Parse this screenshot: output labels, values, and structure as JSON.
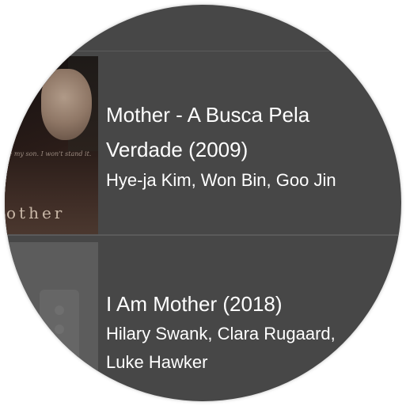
{
  "results": [
    {
      "title": "Mother - A Busca Pela Verdade (2009)",
      "cast": "Hye-ja Kim, Won Bin, Goo Jin",
      "poster": {
        "tagline": "le my son. I won't stand it.",
        "title_text": "other"
      }
    },
    {
      "title": "I Am Mother (2018)",
      "cast": "Hilary Swank, Clara Rugaard, Luke Hawker"
    }
  ],
  "colors": {
    "background": "#474747",
    "text": "#ffffff",
    "separator": "#5c5c5c"
  }
}
